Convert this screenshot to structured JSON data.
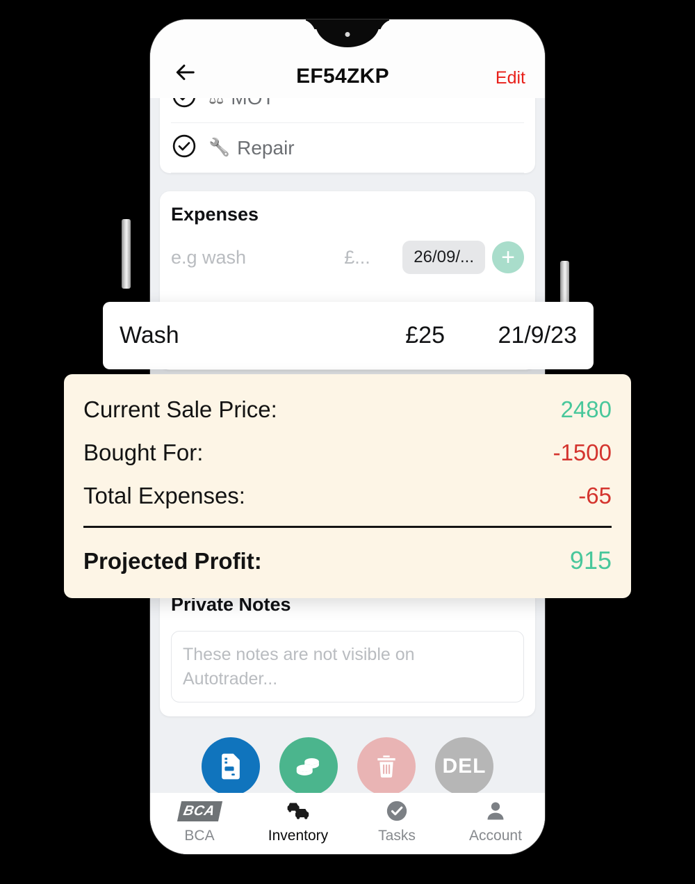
{
  "app": {
    "navbar": {
      "back_icon": "arrow-left-icon",
      "title": "EF54ZKP",
      "edit_label": "Edit"
    },
    "checklist": [
      {
        "label": "MOT",
        "icon": "mot-icon",
        "glyph": "⚖",
        "checked": true
      },
      {
        "label": "Repair",
        "icon": "wrench-icon",
        "glyph": "🔧",
        "checked": true
      }
    ],
    "expenses": {
      "title": "Expenses",
      "name_placeholder": "e.g wash",
      "amount_placeholder": "£...",
      "date_chip": "26/09/...",
      "add_icon": "plus-icon"
    },
    "expense_row": {
      "name": "Wash",
      "amount": "£25",
      "date": "21/9/23"
    },
    "summary": {
      "rows": [
        {
          "label": "Current Sale Price:",
          "value": "2480",
          "sign": "pos"
        },
        {
          "label": "Bought For:",
          "value": "-1500",
          "sign": "neg"
        },
        {
          "label": "Total Expenses:",
          "value": "-65",
          "sign": "neg"
        }
      ],
      "total": {
        "label": "Projected Profit:",
        "value": "915",
        "sign": "pos"
      }
    },
    "notes": {
      "title": "Private Notes",
      "placeholder": "These notes are not visible on Autotrader..."
    },
    "actions": [
      {
        "name": "invoice-button",
        "icon": "invoice-icon",
        "label": ""
      },
      {
        "name": "mark-sold-button",
        "icon": "coins-icon",
        "label": ""
      },
      {
        "name": "delete-button",
        "icon": "trash-icon",
        "label": ""
      },
      {
        "name": "del-button",
        "icon": "del-icon",
        "label": "DEL"
      }
    ],
    "tabs": [
      {
        "label": "BCA",
        "icon": "bca-logo-icon",
        "active": false
      },
      {
        "label": "Inventory",
        "icon": "cars-icon",
        "active": true
      },
      {
        "label": "Tasks",
        "icon": "check-circle-icon",
        "active": false
      },
      {
        "label": "Account",
        "icon": "person-icon",
        "active": false
      }
    ]
  },
  "colors": {
    "accent_green": "#48c79b",
    "accent_red": "#d4342e",
    "edit_red": "#e8201a",
    "cream": "#fdf5e6",
    "mint": "#a9ddcb",
    "screen_bg": "#eef0f3"
  }
}
